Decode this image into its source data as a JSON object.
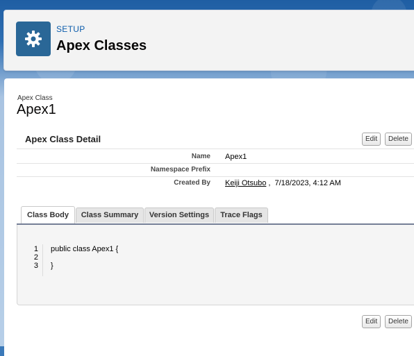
{
  "header": {
    "setup_label": "SETUP",
    "title": "Apex Classes"
  },
  "record": {
    "type_label": "Apex Class",
    "name": "Apex1"
  },
  "detail": {
    "title": "Apex Class Detail",
    "edit_label": "Edit",
    "delete_label": "Delete",
    "fields": {
      "name_label": "Name",
      "name_value": "Apex1",
      "namespace_label": "Namespace Prefix",
      "namespace_value": "",
      "created_label": "Created By",
      "created_user": "Keiji Otsubo",
      "created_sep": ",",
      "created_date": "7/18/2023, 4:12 AM"
    }
  },
  "tabs": [
    {
      "label": "Class Body"
    },
    {
      "label": "Class Summary"
    },
    {
      "label": "Version Settings"
    },
    {
      "label": "Trace Flags"
    }
  ],
  "code": {
    "line_numbers": [
      "1",
      "2",
      "3"
    ],
    "lines": [
      "public class Apex1 {",
      "",
      "}"
    ]
  },
  "colors": {
    "setup_icon_bg": "#2a6797",
    "tab_rule": "#747e96"
  }
}
